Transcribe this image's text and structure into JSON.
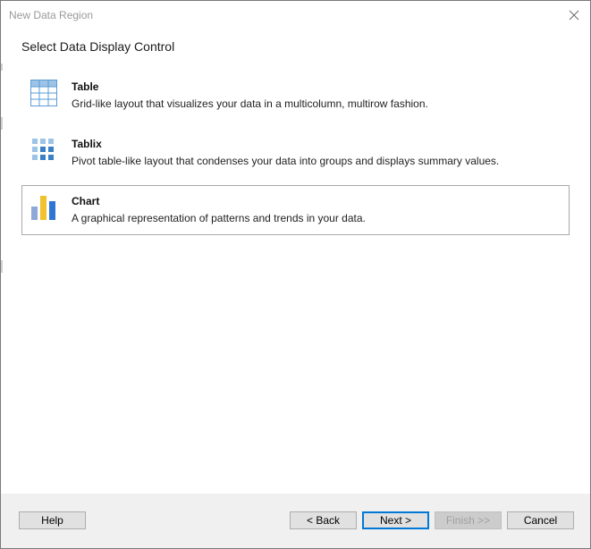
{
  "window": {
    "title": "New Data Region",
    "close_icon": "close-icon"
  },
  "heading": "Select Data Display Control",
  "options": [
    {
      "title": "Table",
      "description": "Grid-like layout that visualizes your data in a multicolumn, multirow fashion.",
      "icon": "table-icon",
      "selected": false
    },
    {
      "title": "Tablix",
      "description": "Pivot table-like layout that condenses your data into groups and displays summary values.",
      "icon": "tablix-icon",
      "selected": false
    },
    {
      "title": "Chart",
      "description": "A graphical representation of patterns and trends in your data.",
      "icon": "chart-icon",
      "selected": true
    }
  ],
  "buttons": {
    "help": "Help",
    "back": "< Back",
    "next": "Next >",
    "finish": "Finish >>",
    "cancel": "Cancel"
  },
  "colors": {
    "accent": "#0078d7",
    "icon_blue": "#3b7fc4",
    "icon_light_blue": "#9dc3e6",
    "chart_gray": "#8fa8d8",
    "chart_yellow": "#f2c12e",
    "chart_blue": "#2e75d6"
  }
}
